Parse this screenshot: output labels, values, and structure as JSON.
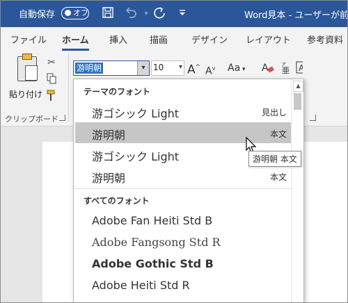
{
  "titlebar": {
    "autosave_label": "自動保存",
    "autosave_state": "オフ",
    "save_icon": "save-icon",
    "undo_icon": "undo-icon",
    "redo_icon": "redo-icon",
    "customize_icon": "customize-qat-icon",
    "title": "Word見本 - ユーザーが前"
  },
  "tabs": [
    "ファイル",
    "ホーム",
    "挿入",
    "描画",
    "デザイン",
    "レイアウト",
    "参考資料"
  ],
  "active_tab": "ホーム",
  "ribbon": {
    "paste_label": "貼り付け",
    "clipboard_label": "クリップボード",
    "font_name": "游明朝",
    "font_size": "10",
    "grow_font": "A",
    "shrink_font": "A",
    "change_case": "Aa",
    "accent_color": "#2b579a"
  },
  "font_dropdown": {
    "theme_header": "テーマのフォント",
    "theme_fonts": [
      {
        "name": "游ゴシック Light",
        "tag": "見出し"
      },
      {
        "name": "游明朝",
        "tag": "本文",
        "hover": true
      },
      {
        "name": "游ゴシック Light",
        "tag": ""
      },
      {
        "name": "游明朝",
        "tag": "本文"
      }
    ],
    "all_header": "すべてのフォント",
    "all_fonts": [
      {
        "name": "Adobe Fan Heiti Std B"
      },
      {
        "name": "Adobe Fangsong Std R"
      },
      {
        "name": "Adobe Gothic Std B"
      },
      {
        "name": "Adobe Heiti Std R"
      }
    ]
  },
  "tooltip": "游明朝 本文"
}
